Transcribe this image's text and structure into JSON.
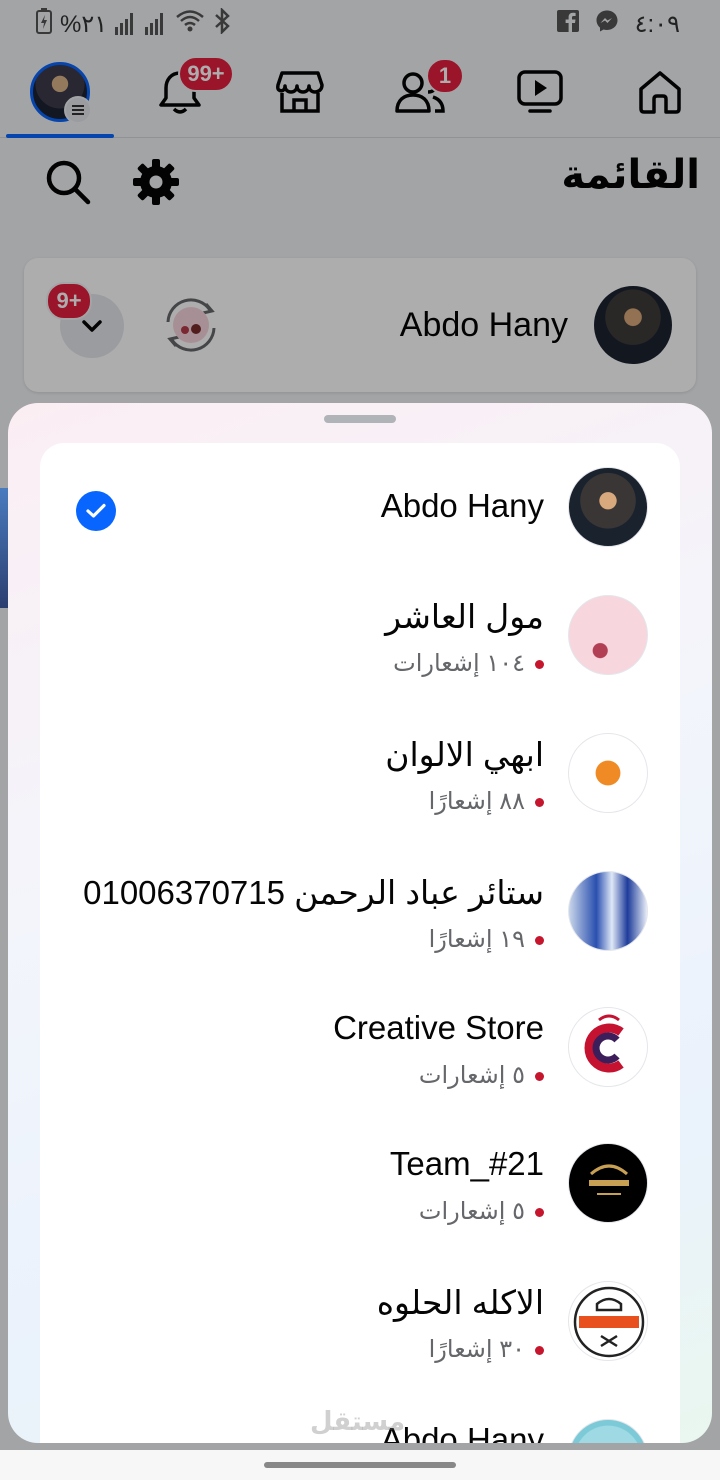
{
  "status_bar": {
    "battery": "%٢١",
    "time": "٤:٠٩"
  },
  "nav": {
    "notifications_badge": "99+",
    "friends_badge": "1",
    "active_tab": "profile-menu"
  },
  "menu": {
    "title": "القائمة"
  },
  "profile_card": {
    "name": "Abdo Hany",
    "switch_badge": "9+"
  },
  "sheet": {
    "accounts": [
      {
        "name": "Abdo Hany",
        "selected": true,
        "notifications": ""
      },
      {
        "name": "مول العاشر",
        "selected": false,
        "notifications": "١٠٤ إشعارات"
      },
      {
        "name": "ابهي الالوان",
        "selected": false,
        "notifications": "٨٨ إشعارًا"
      },
      {
        "name": "ستائر عباد الرحمن 01006370715",
        "selected": false,
        "notifications": "١٩ إشعارًا"
      },
      {
        "name": "Creative Store",
        "selected": false,
        "notifications": "٥ إشعارات"
      },
      {
        "name": "Team_#21",
        "selected": false,
        "notifications": "٥ إشعارات"
      },
      {
        "name": "الاكله الحلوه",
        "selected": false,
        "notifications": "٣٠ إشعارًا"
      },
      {
        "name": "Abdo Hany",
        "selected": false,
        "notifications": ""
      }
    ]
  },
  "watermark": "مستقل",
  "colors": {
    "accent": "#0866ff",
    "badge": "#e41e3f",
    "dot": "#c5162e"
  }
}
